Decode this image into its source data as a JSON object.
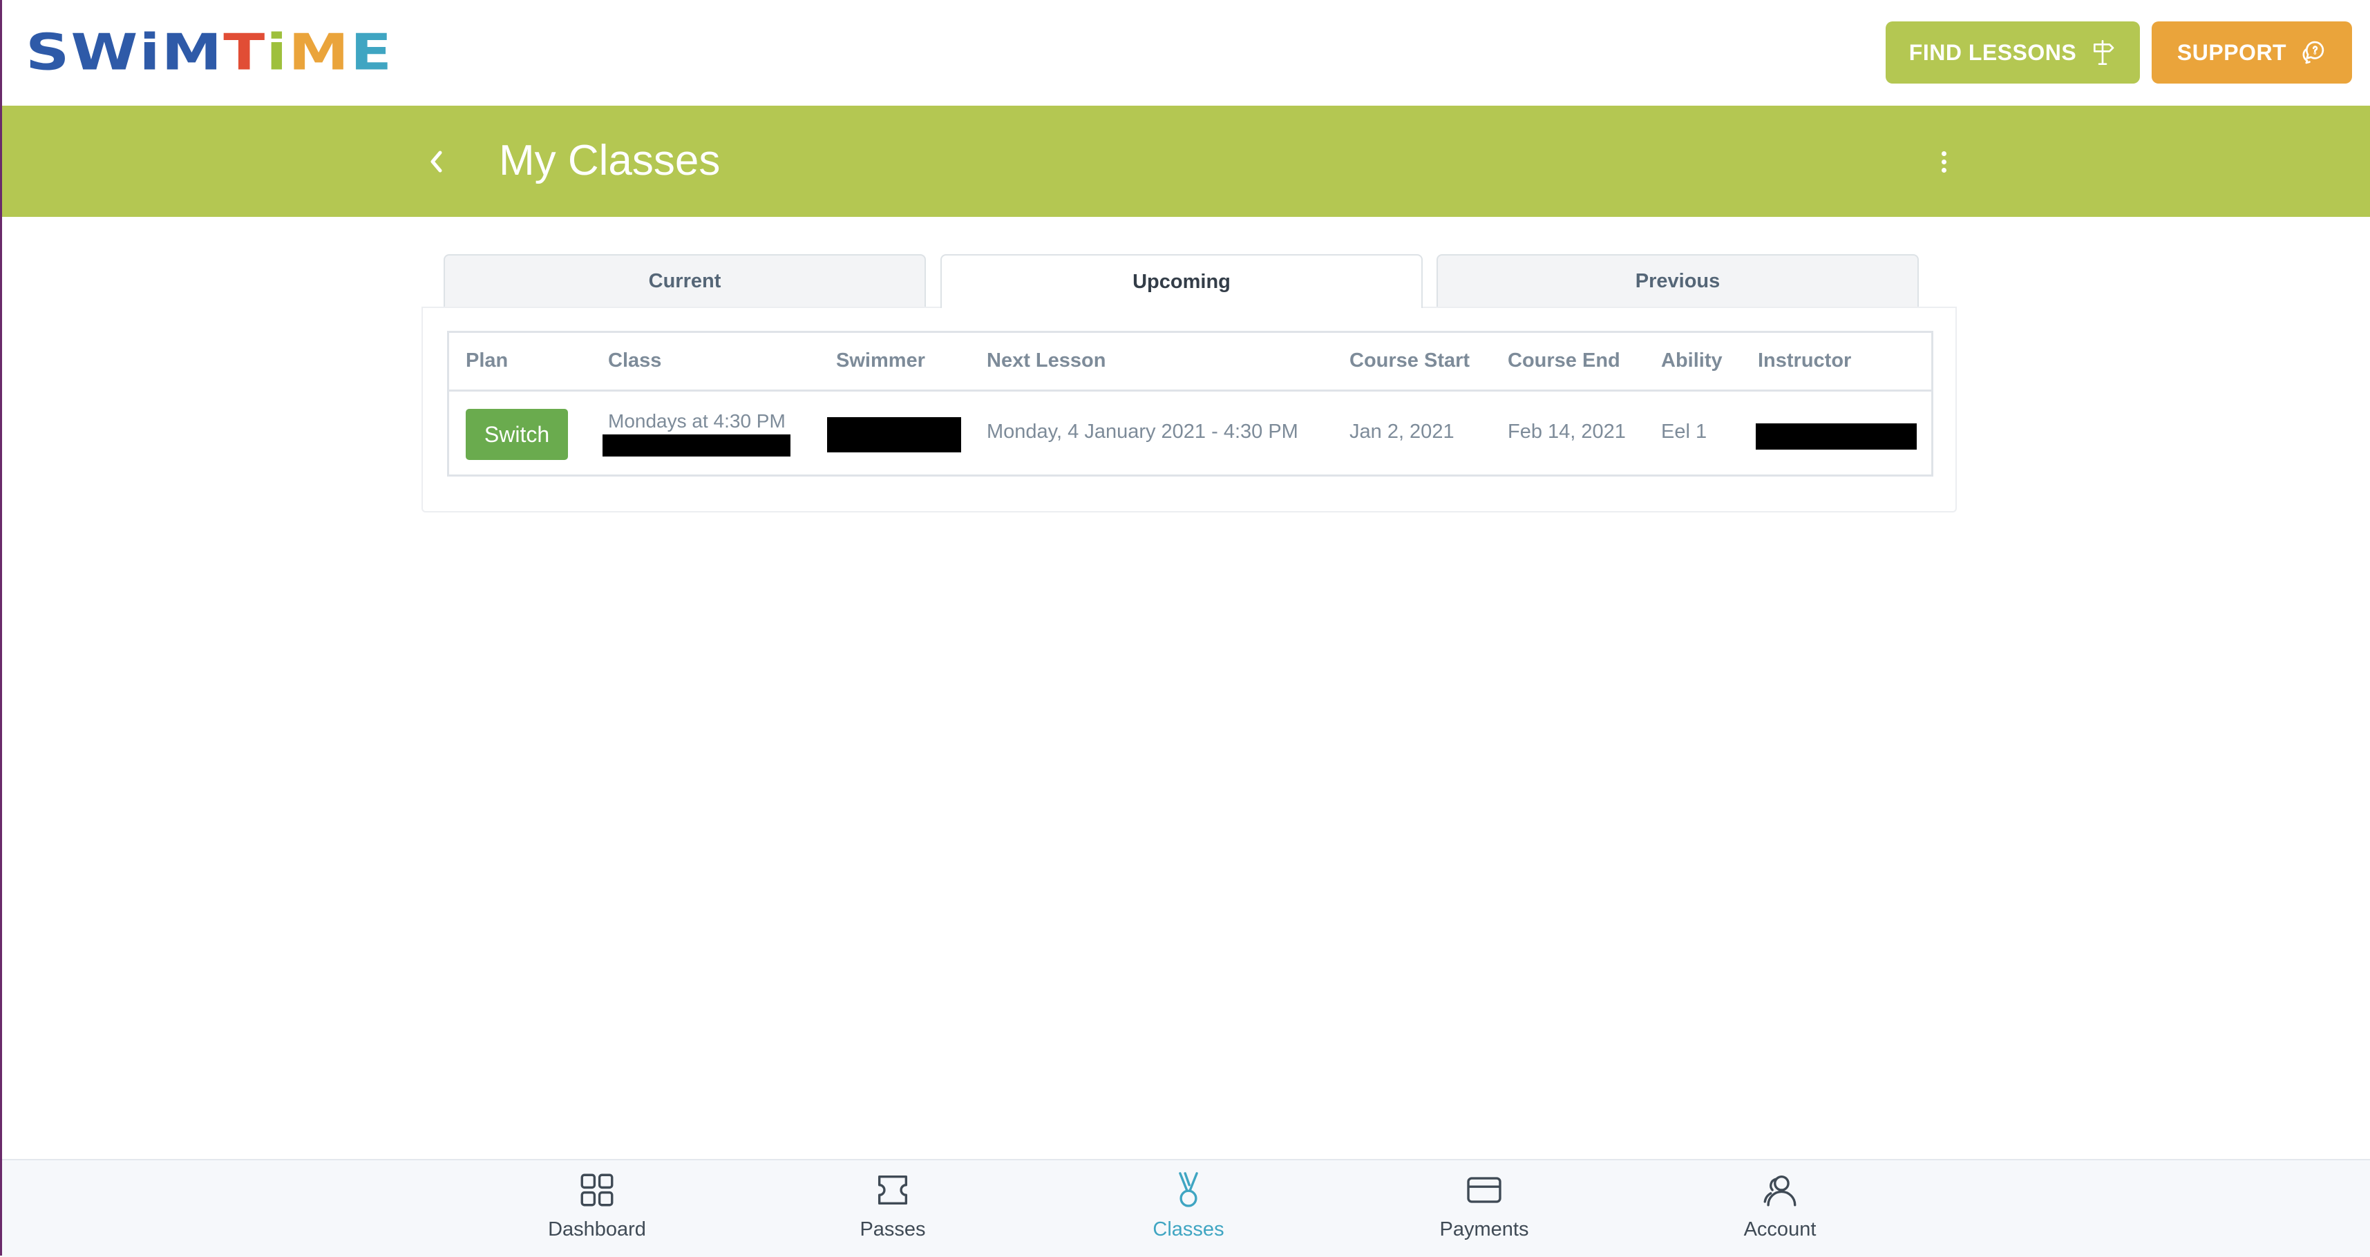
{
  "brand": {
    "logo_letters": [
      {
        "char": "S",
        "color": "#2e5aa8"
      },
      {
        "char": "W",
        "color": "#2e5aa8"
      },
      {
        "char": "i",
        "color": "#2e5aa8"
      },
      {
        "char": "M",
        "color": "#2e5aa8"
      },
      {
        "char": "T",
        "color": "#e14d35"
      },
      {
        "char": "i",
        "color": "#9ec03c"
      },
      {
        "char": "M",
        "color": "#eaa43b"
      },
      {
        "char": "E",
        "color": "#3fa5c2"
      }
    ]
  },
  "header": {
    "find_lessons_label": "FIND LESSONS",
    "find_lessons_icon": "signpost-icon",
    "support_label": "SUPPORT",
    "support_icon": "chat-bubbles-icon"
  },
  "titlebar": {
    "title": "My Classes",
    "back_icon": "chevron-left-icon",
    "menu_icon": "kebab-menu-icon"
  },
  "tabs": [
    {
      "label": "Current",
      "active": false
    },
    {
      "label": "Upcoming",
      "active": true
    },
    {
      "label": "Previous",
      "active": false
    }
  ],
  "table": {
    "columns": [
      "Plan",
      "Class",
      "Swimmer",
      "Next Lesson",
      "Course Start",
      "Course End",
      "Ability",
      "Instructor"
    ],
    "rows": [
      {
        "plan_action": "Switch",
        "class_time": "Mondays at 4:30 PM",
        "next_lesson": "Monday, 4 January 2021 - 4:30 PM",
        "course_start": "Jan 2, 2021",
        "course_end": "Feb 14, 2021",
        "ability": "Eel 1"
      }
    ]
  },
  "bottom_nav": [
    {
      "label": "Dashboard",
      "icon": "grid-icon",
      "active": false
    },
    {
      "label": "Passes",
      "icon": "ticket-icon",
      "active": false
    },
    {
      "label": "Classes",
      "icon": "medal-icon",
      "active": true
    },
    {
      "label": "Payments",
      "icon": "credit-card-icon",
      "active": false
    },
    {
      "label": "Account",
      "icon": "users-icon",
      "active": false
    }
  ],
  "colors": {
    "primary_green": "#b4c752",
    "support_orange": "#eaa43b",
    "switch_green": "#6aab4e",
    "active_nav": "#3fa5c2"
  }
}
